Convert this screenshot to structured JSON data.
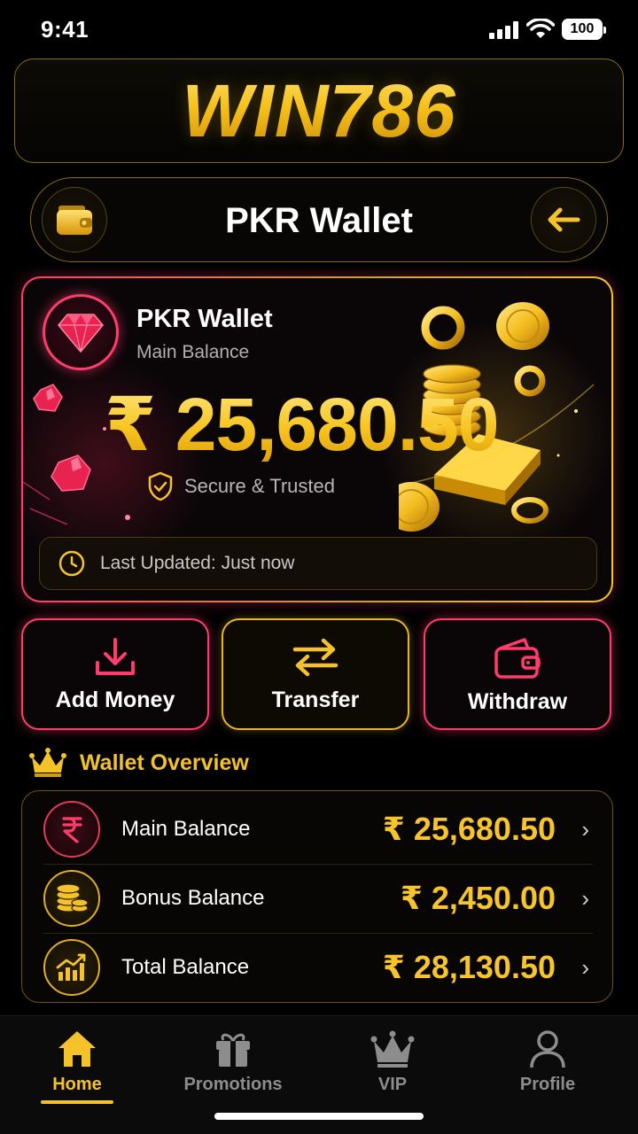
{
  "status_bar": {
    "time": "9:41",
    "battery": "100"
  },
  "brand": {
    "logo": "WIN786",
    "accent": "#F5C22A"
  },
  "header": {
    "title": "PKR Wallet",
    "left_icon": "wallet-icon",
    "right_icon": "back-arrow-icon"
  },
  "balance_card": {
    "title": "PKR Wallet",
    "subtitle": "Main Balance",
    "amount": "₹ 25,680.50",
    "secure_text": "Secure & Trusted",
    "last_updated": "Last Updated: Just now"
  },
  "actions": [
    {
      "label": "Add Money",
      "icon": "download-icon",
      "style": "red"
    },
    {
      "label": "Transfer",
      "icon": "transfer-arrows-icon",
      "style": "gold"
    },
    {
      "label": "Withdraw",
      "icon": "wallet-icon",
      "style": "red"
    }
  ],
  "overview": {
    "title": "Wallet Overview",
    "rows": [
      {
        "label": "Main Balance",
        "value": "₹ 25,680.50",
        "icon": "rupee-icon"
      },
      {
        "label": "Bonus Balance",
        "value": "₹ 2,450.00",
        "icon": "coins-stack-icon"
      },
      {
        "label": "Total Balance",
        "value": "₹ 28,130.50",
        "icon": "growth-chart-icon"
      }
    ]
  },
  "tabs": [
    {
      "label": "Home",
      "icon": "home-icon",
      "active": true
    },
    {
      "label": "Promotions",
      "icon": "gift-icon",
      "active": false
    },
    {
      "label": "VIP",
      "icon": "crown-icon",
      "active": false
    },
    {
      "label": "Profile",
      "icon": "profile-icon",
      "active": false
    }
  ],
  "colors": {
    "gold": "#F5C22A",
    "red": "#FF3C6E",
    "background": "#000000"
  }
}
